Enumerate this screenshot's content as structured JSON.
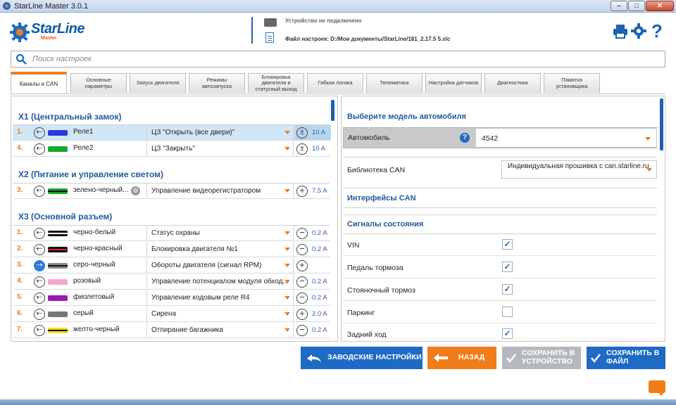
{
  "window": {
    "title": "StarLine Master 3.0.1",
    "min": "–",
    "max": "□",
    "close": "✕"
  },
  "header": {
    "logo": "StarLine",
    "logo_sub": "Master",
    "device_status": "Устройство не подключено",
    "file_path": "Файл настроек: D:/Мои документы/StarLine/181_2.17.5  5.slc",
    "icons": [
      "printer-icon",
      "gear-icon",
      "help-icon"
    ]
  },
  "search": {
    "placeholder": "Поиск настроек"
  },
  "tabs": [
    "Каналы и CAN",
    "Основные параметры",
    "Запуск двигателя",
    "Режимы автозапуска",
    "Блокировка двигателя и статусный выход",
    "Гибкая логика",
    "Телематика",
    "Настройка датчиков",
    "Диагностика",
    "Памятка установщика"
  ],
  "left": {
    "sections": [
      {
        "title": "X1 (Центральный замок)"
      },
      {
        "title": "X2 (Питание и управление светом)"
      },
      {
        "title": "X3 (Основной разъем)"
      }
    ],
    "rows": [
      {
        "num": "1.",
        "dir": "⇠",
        "wire": "#2a3bd8",
        "stripe": "",
        "name": "Реле1",
        "func": "ЦЗ \"Открыть (все двери)\"",
        "amp": "±",
        "cur": "10 A"
      },
      {
        "num": "4.",
        "dir": "⇠",
        "wire": "#18a82a",
        "stripe": "",
        "name": "Реле2",
        "func": "ЦЗ \"Закрыть\"",
        "amp": "±",
        "cur": "10 A"
      },
      {
        "num": "3.",
        "dir": "⇠",
        "wire": "#18a82a",
        "stripe": "#111",
        "name": "зелено-черный...",
        "func": "Управление видеорегистратором",
        "amp": "+",
        "cur": "7.5 A"
      },
      {
        "num": "1.",
        "dir": "⇠",
        "wire": "#111",
        "stripe": "#fff",
        "name": "черно-белый",
        "func": "Статус охраны",
        "amp": "−",
        "cur": "0.2 A"
      },
      {
        "num": "2.",
        "dir": "⇠",
        "wire": "#111",
        "stripe": "#d42020",
        "name": "черно-красный",
        "func": "Блокировка двигателя №1",
        "amp": "−",
        "cur": "0.2 A"
      },
      {
        "num": "3.",
        "dir": "⇢",
        "wire": "#888",
        "stripe": "#111",
        "name": "серо-черный",
        "func": "Обороты двигателя (сигнал RPM)",
        "amp": "+",
        "cur": ""
      },
      {
        "num": "4.",
        "dir": "⇠",
        "wire": "#f4a7cf",
        "stripe": "",
        "name": "розовый",
        "func": "Управление потенциалом модуля обход...",
        "amp": "−",
        "cur": "0.2 A"
      },
      {
        "num": "5.",
        "dir": "⇠",
        "wire": "#9a18b8",
        "stripe": "",
        "name": "фиолетовый",
        "func": "Управление кодовым реле R4",
        "amp": "−",
        "cur": "0.2 A"
      },
      {
        "num": "6.",
        "dir": "⇠",
        "wire": "#777",
        "stripe": "",
        "name": "серый",
        "func": "Сирена",
        "amp": "+",
        "cur": "2.0 A"
      },
      {
        "num": "7.",
        "dir": "⇠",
        "wire": "#f2e21a",
        "stripe": "#111",
        "name": "желто-черный",
        "func": "Отпирание багажника",
        "amp": "−",
        "cur": "0.2 A"
      }
    ]
  },
  "right": {
    "model_title": "Выберите модель автомобиля",
    "car_label": "Автомобиль",
    "car_value": "4542",
    "canlib_label": "Библиотека CAN",
    "canlib_value": "Индивидуальная прошивка с can.starline.ru",
    "can_interfaces_title": "Интерфейсы CAN",
    "signals_title": "Сигналы состояния",
    "signals": [
      {
        "label": "VIN",
        "checked": "✓"
      },
      {
        "label": "Педаль тормоза",
        "checked": "✓"
      },
      {
        "label": "Стояночный тормоз",
        "checked": "✓"
      },
      {
        "label": "Паркинг",
        "checked": ""
      },
      {
        "label": "Задний ход",
        "checked": "✓"
      }
    ]
  },
  "buttons": {
    "factory": "ЗАВОДСКИЕ НАСТРОЙКИ",
    "back": "НАЗАД",
    "save_device": "СОХРАНИТЬ В УСТРОЙСТВО",
    "save_file": "СОХРАНИТЬ В ФАЙЛ"
  },
  "colors": {
    "accent_orange": "#f07d1a",
    "accent_blue": "#1e6ac4",
    "section_blue": "#1f5a9e"
  }
}
